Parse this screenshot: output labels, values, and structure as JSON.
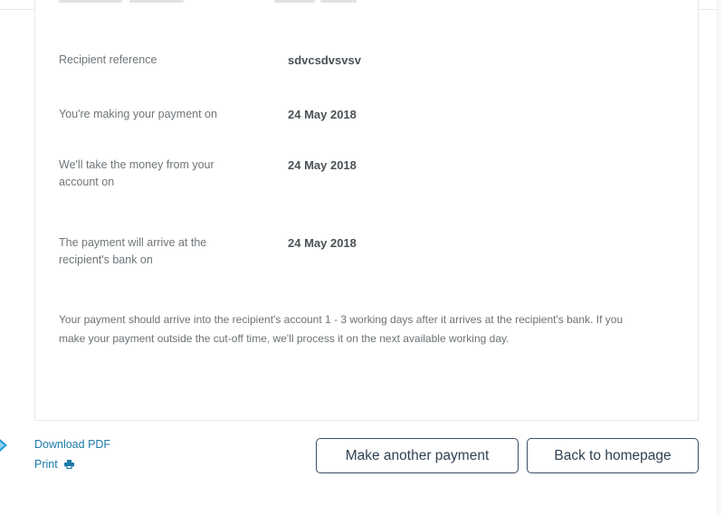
{
  "details": [
    {
      "label": "Recipient reference",
      "value": "sdvcsdvsvsv"
    },
    {
      "label": "You're making your payment on",
      "value": "24 May 2018"
    },
    {
      "label": "We'll take the money from your account on",
      "value": "24 May 2018"
    },
    {
      "label": "The payment will arrive at the recipient's bank on",
      "value": "24 May 2018"
    }
  ],
  "notice": "Your payment should arrive into the recipient's account 1 - 3 working days after it arrives at the recipient's bank. If you make your payment outside the cut-off time, we'll process it on the next available working day.",
  "links": {
    "download_pdf": "Download PDF",
    "print": "Print"
  },
  "buttons": {
    "make_another_payment": "Make another payment",
    "back_to_homepage": "Back to homepage"
  },
  "icons": {
    "print": "printer-icon",
    "pointer": "arrow-right-icon"
  },
  "colors": {
    "link": "#1b79a8",
    "button_border": "#3c4d60",
    "text": "#6f7579",
    "value_text": "#4b5256"
  }
}
